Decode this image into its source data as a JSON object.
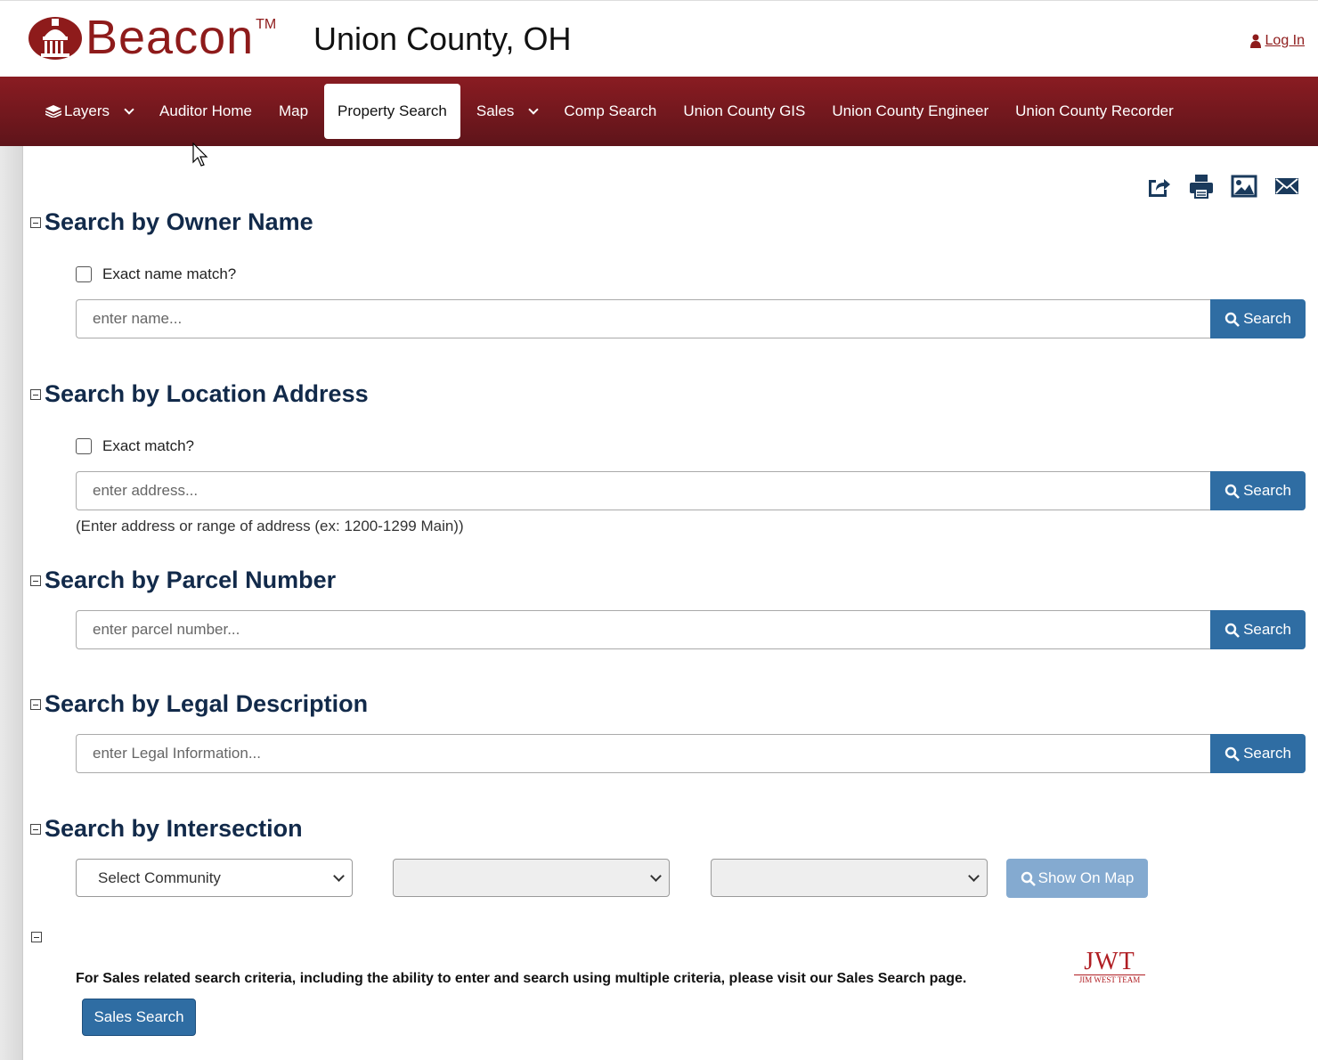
{
  "header": {
    "logo_text": "Beacon",
    "logo_tm": "TM",
    "county": "Union County, OH",
    "login_label": "Log In"
  },
  "nav": {
    "items": [
      {
        "label": "Layers",
        "dropdown": true,
        "icon": "layers-icon"
      },
      {
        "label": "Auditor Home"
      },
      {
        "label": "Map"
      },
      {
        "label": "Property Search",
        "active": true
      },
      {
        "label": "Sales",
        "dropdown": true
      },
      {
        "label": "Comp Search"
      },
      {
        "label": "Union County GIS"
      },
      {
        "label": "Union County Engineer"
      },
      {
        "label": "Union County Recorder"
      }
    ]
  },
  "toolbar": {
    "icons": [
      "share-icon",
      "print-icon",
      "image-icon",
      "email-icon"
    ]
  },
  "owner": {
    "title": "Search by Owner Name",
    "checkbox_label": "Exact name match?",
    "placeholder": "enter name...",
    "button": "Search"
  },
  "address": {
    "title": "Search by Location Address",
    "checkbox_label": "Exact match?",
    "placeholder": "enter address...",
    "button": "Search",
    "hint": "(Enter address or range of address (ex: 1200-1299 Main))"
  },
  "parcel": {
    "title": "Search by Parcel Number",
    "placeholder": "enter parcel number...",
    "button": "Search"
  },
  "legal": {
    "title": "Search by Legal Description",
    "placeholder": "enter Legal Information...",
    "button": "Search"
  },
  "intersection": {
    "title": "Search by Intersection",
    "community_selected": "Select Community",
    "street1_selected": "",
    "street2_selected": "",
    "button": "Show On Map"
  },
  "sales": {
    "text": "For Sales related search criteria, including the ability to enter and search using multiple criteria, please visit our Sales Search page.",
    "button": "Sales Search",
    "sponsor_big": "JWT",
    "sponsor_small": "JIM WEST TEAM"
  },
  "colors": {
    "brand": "#8e1b1b",
    "nav_bg": "#7a1a20",
    "button": "#2f6da3",
    "heading": "#122a4a"
  }
}
